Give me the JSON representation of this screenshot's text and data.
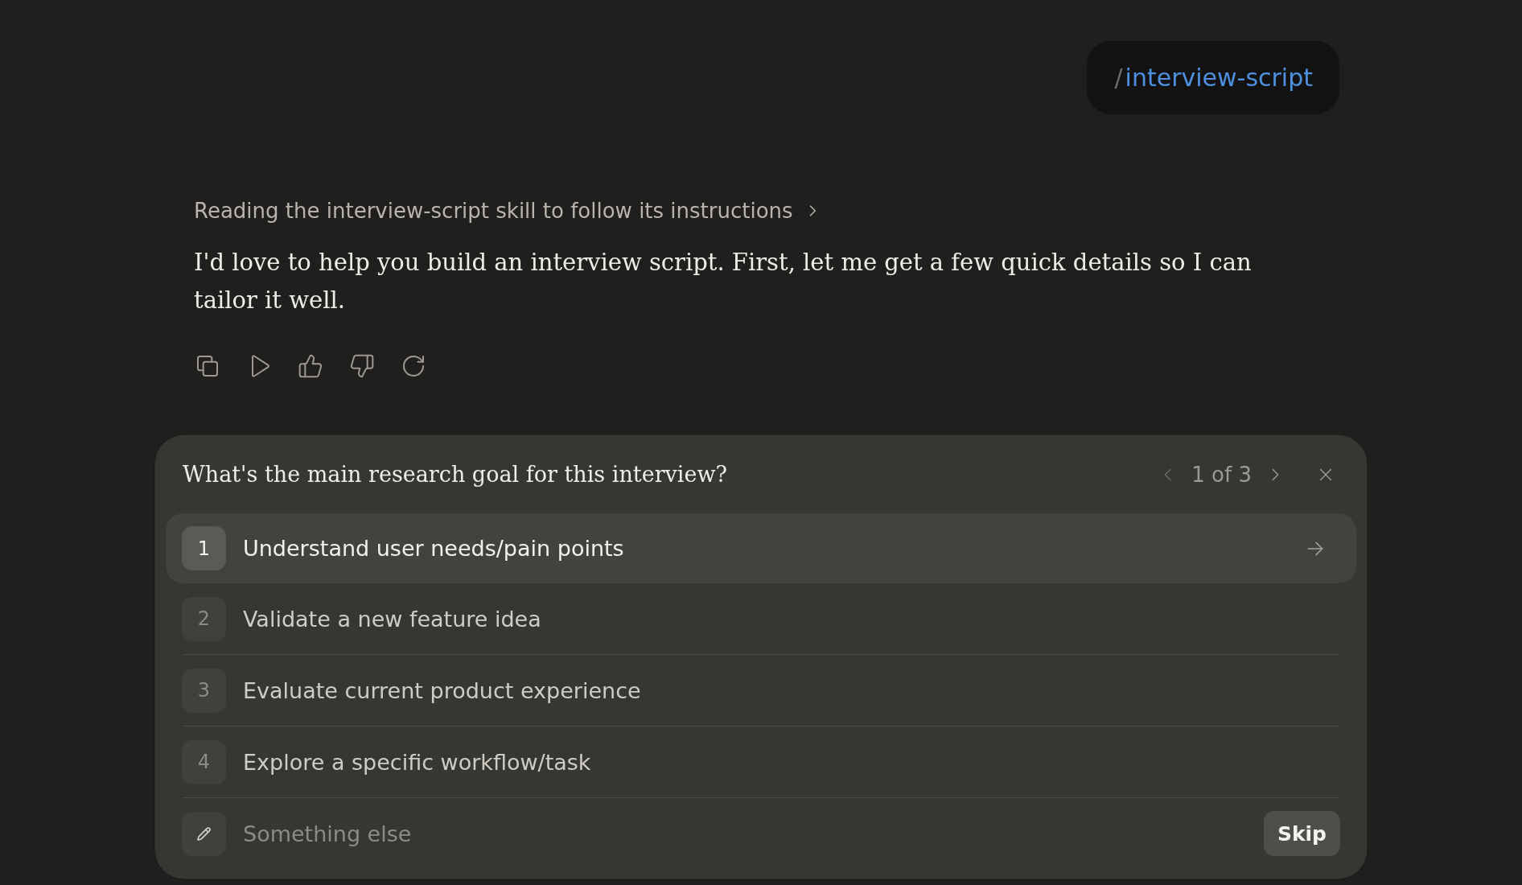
{
  "command_chip": {
    "prefix": "/",
    "command": "interview-script"
  },
  "status_line": "Reading the interview-script skill to follow its instructions",
  "message": "I'd love to help you build an interview script. First, let me get a few quick details so I can tailor it well.",
  "question_card": {
    "question": "What's the main research goal for this interview?",
    "pager": {
      "text": "1 of 3",
      "prev_disabled": true,
      "next_disabled": false
    },
    "options": [
      {
        "number": "1",
        "label": "Understand user needs/pain points",
        "selected": true
      },
      {
        "number": "2",
        "label": "Validate a new feature idea",
        "selected": false
      },
      {
        "number": "3",
        "label": "Evaluate current product experience",
        "selected": false
      },
      {
        "number": "4",
        "label": "Explore a specific workflow/task",
        "selected": false
      }
    ],
    "custom_answer": {
      "placeholder": "Something else"
    },
    "skip_button": "Skip"
  }
}
